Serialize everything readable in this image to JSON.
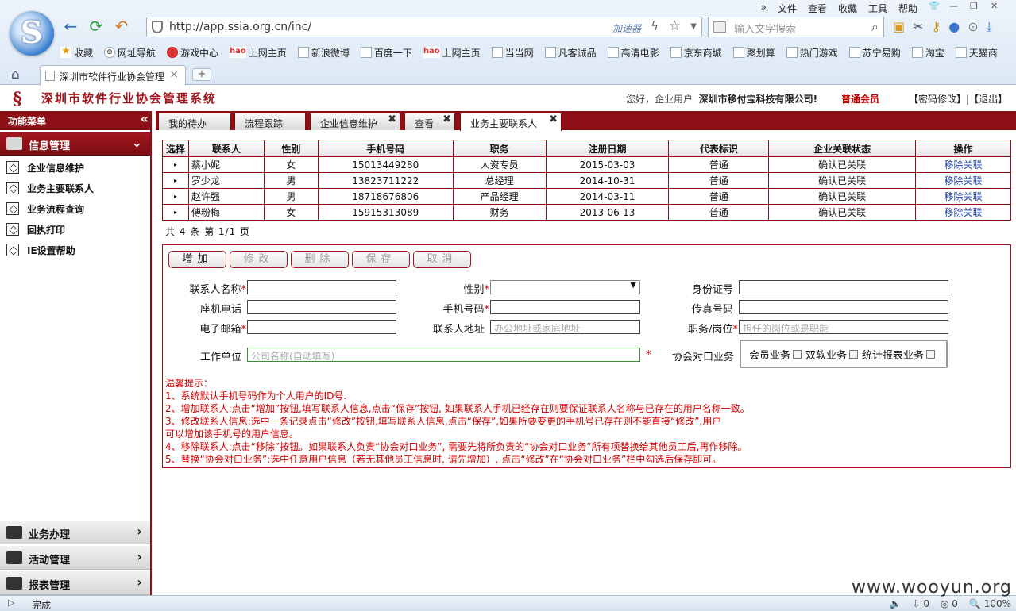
{
  "browser": {
    "menu": [
      "»",
      "文件",
      "查看",
      "收藏",
      "工具",
      "帮助"
    ],
    "url": "http://app.ssia.org.cn/inc/",
    "accelerator": "加速器",
    "search_placeholder": "输入文字搜索",
    "favorites": [
      "收藏",
      "网址导航",
      "游戏中心",
      "上网主页",
      "新浪微博",
      "百度一下",
      "上网主页",
      "当当网",
      "凡客诚品",
      "高清电影",
      "京东商城",
      "聚划算",
      "热门游戏",
      "苏宁易购",
      "淘宝",
      "天猫商"
    ],
    "tab_title": "深圳市软件行业协会管理",
    "status": "完成",
    "status_counts": [
      "0",
      "0"
    ],
    "zoom": "100%",
    "watermark": "www.wooyun.org"
  },
  "app": {
    "title": "深圳市软件行业协会管理系统",
    "welcome": "您好，企业用户",
    "company": "深圳市移付宝科技有限公司!",
    "member_level": "普通会员",
    "change_password": "【密码修改】",
    "separator": "|",
    "logout": "【退出】"
  },
  "sidebar": {
    "header": "功能菜单",
    "collapse": "«",
    "groups": [
      {
        "label": "信息管理",
        "arrow": "⌄"
      },
      {
        "label": "业务办理",
        "arrow": "›"
      },
      {
        "label": "活动管理",
        "arrow": "›"
      },
      {
        "label": "报表管理",
        "arrow": "›"
      }
    ],
    "items": [
      "企业信息维护",
      "业务主要联系人",
      "业务流程查询",
      "回执打印",
      "IE设置帮助"
    ]
  },
  "tabs": [
    {
      "label": "我的待办",
      "close": ""
    },
    {
      "label": "流程跟踪",
      "close": ""
    },
    {
      "label": "企业信息维护",
      "close": "✖"
    },
    {
      "label": "查看",
      "close": "✖"
    },
    {
      "label": "业务主要联系人",
      "close": "✖"
    }
  ],
  "table": {
    "headers": [
      "选择",
      "联系人",
      "性别",
      "手机号码",
      "职务",
      "注册日期",
      "代表标识",
      "企业关联状态",
      "操作"
    ],
    "rows": [
      [
        "▸",
        "蔡小妮",
        "女",
        "15013449280",
        "人资专员",
        "2015-03-03",
        "普通",
        "确认已关联",
        "移除关联"
      ],
      [
        "▸",
        "罗少龙",
        "男",
        "13823711222",
        "总经理",
        "2014-10-31",
        "普通",
        "确认已关联",
        "移除关联"
      ],
      [
        "▸",
        "赵许强",
        "男",
        "18718676806",
        "产品经理",
        "2014-03-11",
        "普通",
        "确认已关联",
        "移除关联"
      ],
      [
        "▸",
        "傅粉梅",
        "女",
        "15915313089",
        "财务",
        "2013-06-13",
        "普通",
        "确认已关联",
        "移除关联"
      ]
    ],
    "pager": "共 4 条 第 1/1 页"
  },
  "buttons": [
    "增加",
    "修改",
    "删除",
    "保存",
    "取消"
  ],
  "form": {
    "contact_name": "联系人名称",
    "gender": "性别",
    "id_number": "身份证号",
    "landline": "座机电话",
    "mobile": "手机号码",
    "fax": "传真号码",
    "email": "电子邮箱",
    "address": "联系人地址",
    "address_placeholder": "办公地址或家庭地址",
    "position": "职务/岗位",
    "position_placeholder": "担任的岗位或是职能",
    "work_unit": "工作单位",
    "work_unit_placeholder": "公司名称(自动填写)",
    "assoc_business": "协会对口业务",
    "biz_options": [
      "会员业务",
      "双软业务",
      "统计报表业务"
    ],
    "required_mark": "*"
  },
  "tips": [
    "温馨提示：",
    "1、系统默认手机号码作为个人用户的ID号.",
    "2、增加联系人:点击“增加”按钮,填写联系人信息,点击“保存”按钮, 如果联系人手机已经存在则要保证联系人名称与已存在的用户名称一致。",
    "3、修改联系人信息:选中一条记录点击“修改”按钮,填写联系人信息,点击“保存”,如果所要变更的手机号已存在则不能直接“修改”,用户",
    "可以增加该手机号的用户信息。",
    "4、移除联系人:点击“移除”按钮。如果联系人负责“协会对口业务”, 需要先将所负责的“协会对口业务”所有项替换给其他员工后,再作移除。",
    "5、替换“协会对口业务”:选中任意用户信息（若无其他员工信息时, 请先增加）, 点击“修改”在“协会对口业务”栏中勾选后保存即可。"
  ]
}
